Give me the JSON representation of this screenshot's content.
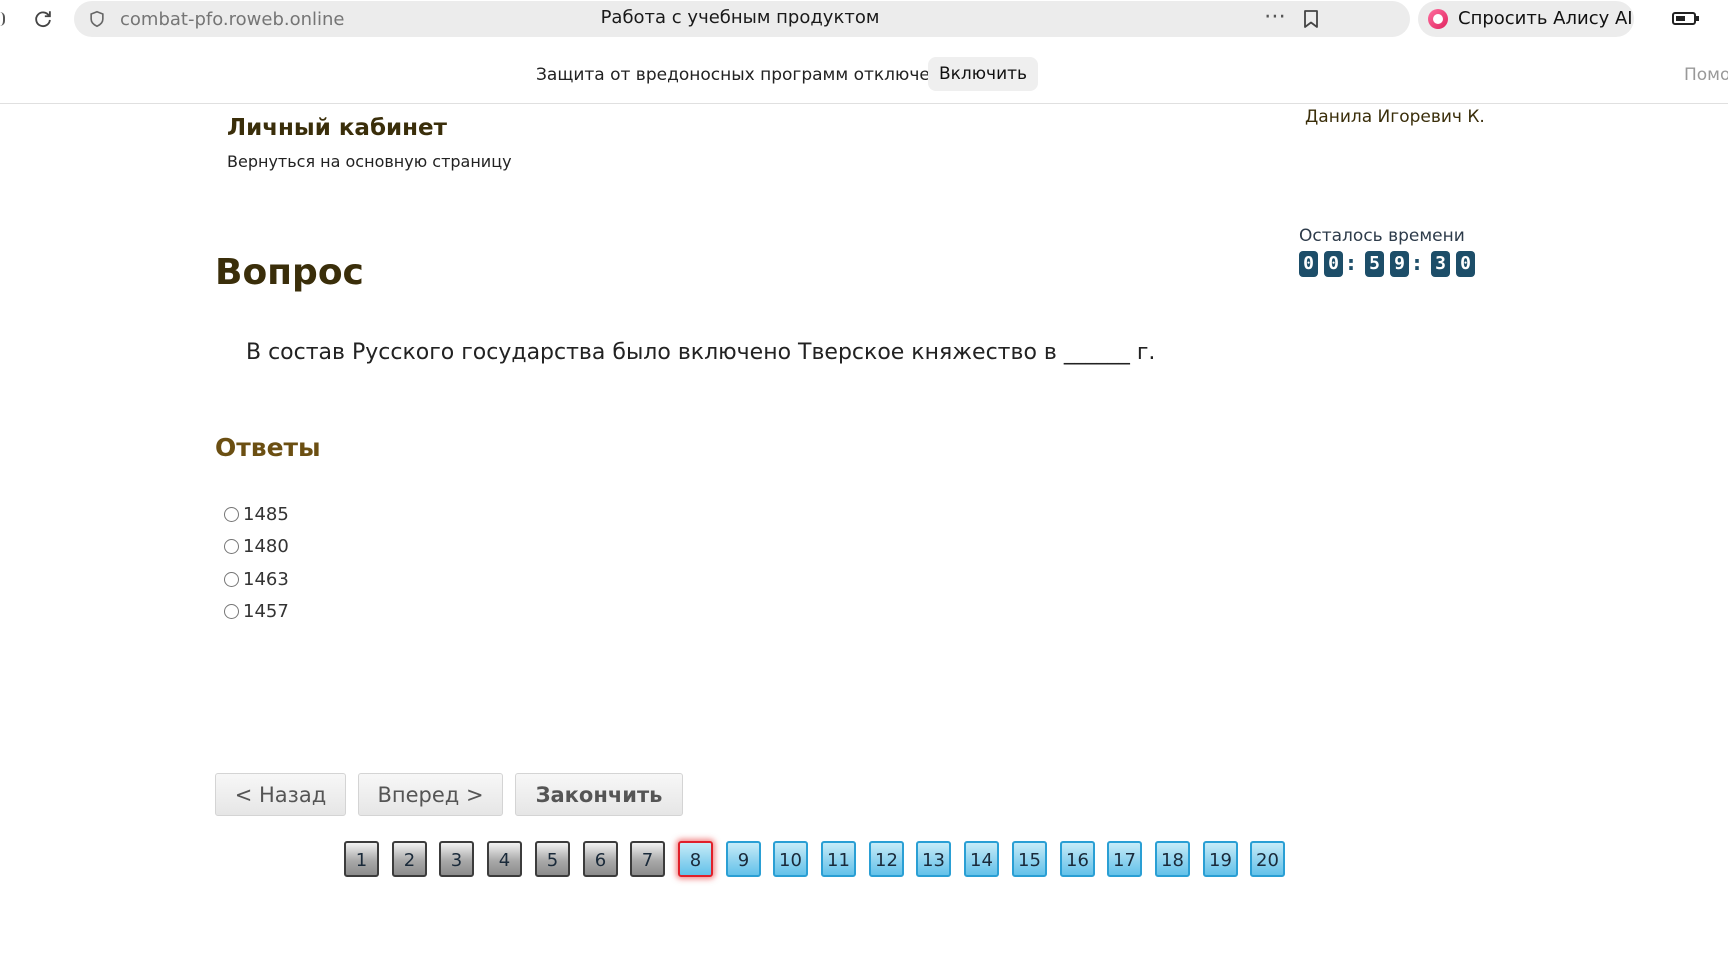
{
  "browser": {
    "url": "combat-pfo.roweb.online",
    "title": "Работа с учебным продуктом",
    "more_icon": "⋯",
    "alisa_label": "Спросить Алису AI"
  },
  "notice": {
    "text": "Защита от вредоносных программ отключена",
    "enable_label": "Включить",
    "help_cut": "Помо"
  },
  "header": {
    "cabinet_title": "Личный кабинет",
    "back_link": "Вернуться на основную страницу",
    "user_name": "Данила Игоревич К."
  },
  "timer": {
    "label": "Осталось времени",
    "digits": [
      "0",
      "0",
      "5",
      "9",
      "3",
      "0"
    ],
    "separator": ":"
  },
  "question": {
    "heading": "Вопрос",
    "text": "В состав Русского государства было включено Тверское княжество в ______ г."
  },
  "answers": {
    "heading": "Ответы",
    "options": [
      "1485",
      "1480",
      "1463",
      "1457"
    ]
  },
  "navigation": {
    "back_label": "< Назад",
    "forward_label": "Вперед >",
    "finish_label": "Закончить"
  },
  "pager": {
    "pages": [
      "1",
      "2",
      "3",
      "4",
      "5",
      "6",
      "7",
      "8",
      "9",
      "10",
      "11",
      "12",
      "13",
      "14",
      "15",
      "16",
      "17",
      "18",
      "19",
      "20"
    ],
    "current": 8,
    "answered_up_to": 7
  }
}
